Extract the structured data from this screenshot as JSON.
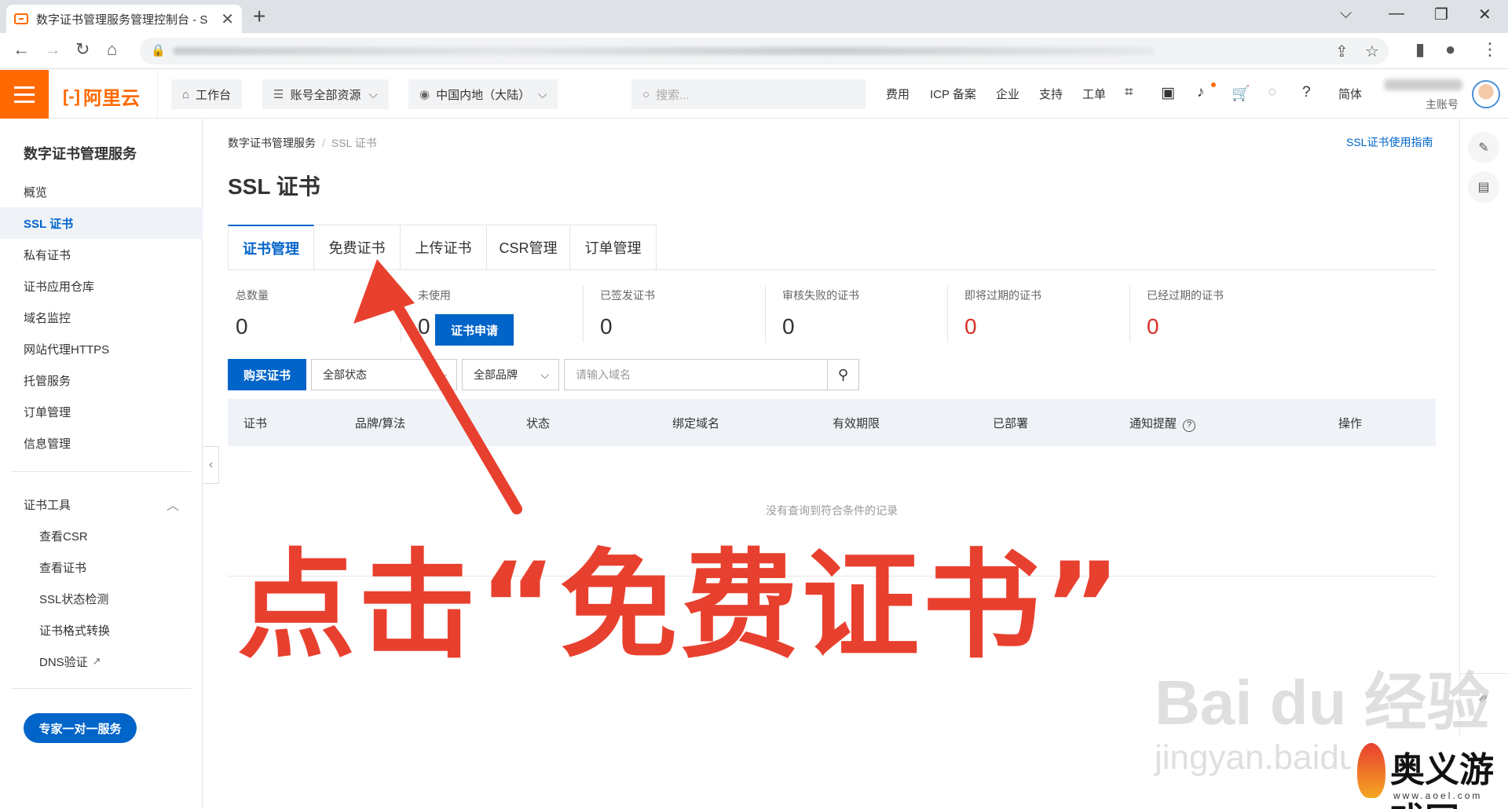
{
  "browser": {
    "tab_title": "数字证书管理服务管理控制台 - S",
    "tab_close": "✕",
    "new_tab": "+",
    "win_controls": [
      "⌵",
      "—",
      "❐",
      "✕"
    ]
  },
  "topbar": {
    "logo": "阿里云",
    "workbench": "工作台",
    "resources": "账号全部资源",
    "region": "中国内地（大陆）",
    "search_placeholder": "搜索...",
    "links": [
      "费用",
      "ICP 备案",
      "企业",
      "支持",
      "工单"
    ],
    "lang": "简体",
    "account_label": "主账号"
  },
  "sidebar": {
    "title": "数字证书管理服务",
    "items": [
      "概览",
      "SSL 证书",
      "私有证书",
      "证书应用仓库",
      "域名监控",
      "网站代理HTTPS",
      "托管服务",
      "订单管理",
      "信息管理"
    ],
    "active_index": 1,
    "tools_title": "证书工具",
    "tools": [
      "查看CSR",
      "查看证书",
      "SSL状态检测",
      "证书格式转换",
      "DNS验证"
    ],
    "expert_button": "专家一对一服务"
  },
  "main": {
    "breadcrumb": [
      "数字证书管理服务",
      "SSL 证书"
    ],
    "guide_link": "SSL证书使用指南",
    "title": "SSL 证书",
    "tabs": [
      "证书管理",
      "免费证书",
      "上传证书",
      "CSR管理",
      "订单管理"
    ],
    "stats": [
      {
        "label": "总数量",
        "value": "0",
        "color": "#333333"
      },
      {
        "label": "未使用",
        "value": "0",
        "color": "#333333"
      },
      {
        "label": "已签发证书",
        "value": "0",
        "color": "#333333"
      },
      {
        "label": "审核失败的证书",
        "value": "0",
        "color": "#333333"
      },
      {
        "label": "即将过期的证书",
        "value": "0",
        "color": "#d93026"
      },
      {
        "label": "已经过期的证书",
        "value": "0",
        "color": "#d93026"
      }
    ],
    "apply_button": "证书申请",
    "buy_button": "购买证书",
    "status_filter": "全部状态",
    "brand_filter": "全部品牌",
    "domain_placeholder": "请输入域名",
    "columns": [
      "证书",
      "品牌/算法",
      "状态",
      "绑定域名",
      "有效期限",
      "已部署",
      "通知提醒",
      "操作"
    ],
    "empty_text": "没有查询到符合条件的记录"
  },
  "annotation": {
    "text": "点击“免费证书”",
    "color": "#e8402f"
  },
  "watermark": {
    "main": "Bai du 经验",
    "sub": "jingyan.baidu",
    "corner_brand": "奥义游戏网",
    "corner_url": "www.aoel.com"
  }
}
